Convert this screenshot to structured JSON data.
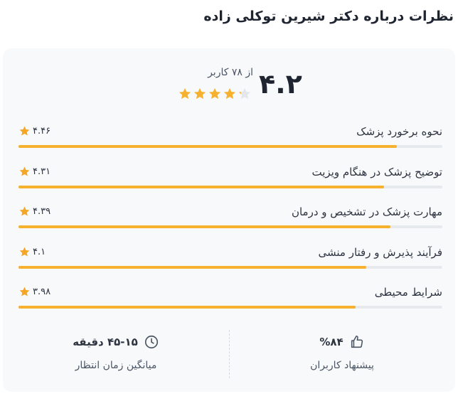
{
  "page_title": "نظرات درباره دکتر شیرین توکلی زاده",
  "summary": {
    "score": "۴.۲",
    "users_count": "از ۷۸ کاربر",
    "stars_rating": 4.2
  },
  "accent_color": "#f6b12f",
  "ratings": [
    {
      "label": "نحوه برخورد پزشک",
      "value": "۴.۴۶",
      "score": 4.46
    },
    {
      "label": "توضیح پزشک در هنگام ویزیت",
      "value": "۴.۳۱",
      "score": 4.31
    },
    {
      "label": "مهارت پزشک در تشخیص و درمان",
      "value": "۴.۳۹",
      "score": 4.39
    },
    {
      "label": "فرآیند پذیرش و رفتار منشی",
      "value": "۴.۱",
      "score": 4.1
    },
    {
      "label": "شرایط محیطی",
      "value": "۳.۹۸",
      "score": 3.98
    }
  ],
  "footer": {
    "wait_time": {
      "value": "۴۵-۱۵ دقیقه",
      "label": "میانگین زمان انتظار",
      "icon": "clock-icon"
    },
    "recommend": {
      "value": "%۸۴",
      "label": "پیشنهاد کاربران",
      "icon": "thumbs-up-icon"
    }
  }
}
